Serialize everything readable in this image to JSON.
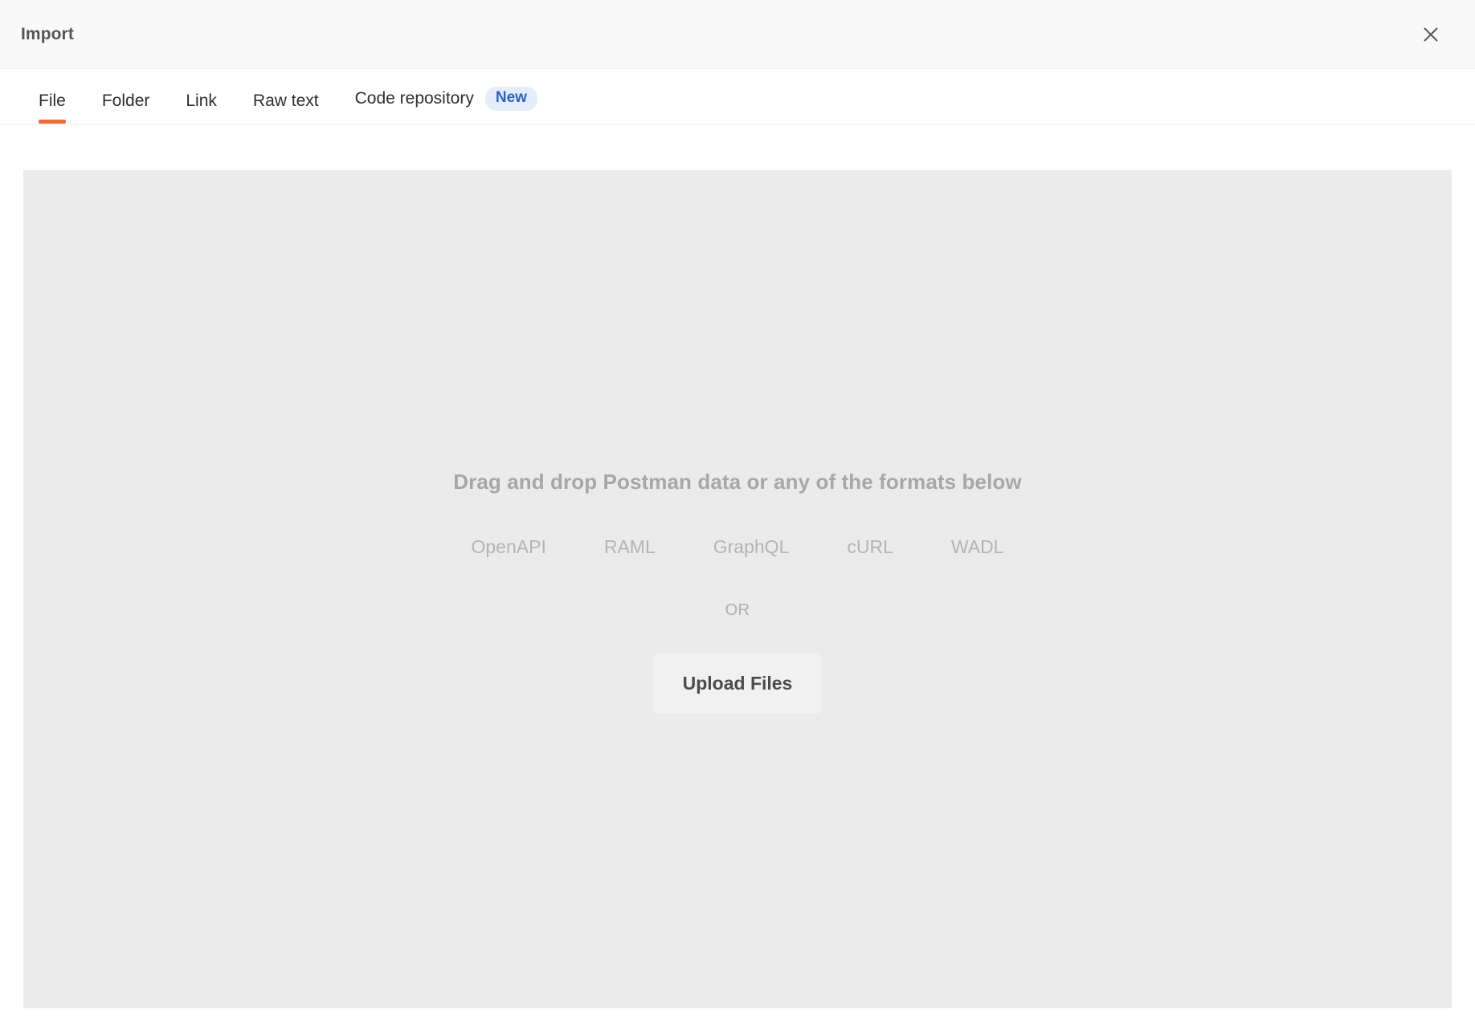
{
  "header": {
    "title": "Import",
    "close_icon": "close-icon"
  },
  "tabs": [
    {
      "label": "File",
      "active": true
    },
    {
      "label": "Folder",
      "active": false
    },
    {
      "label": "Link",
      "active": false
    },
    {
      "label": "Raw text",
      "active": false
    },
    {
      "label": "Code repository",
      "active": false,
      "badge": "New"
    }
  ],
  "dropzone": {
    "headline": "Drag and drop Postman data or any of the formats below",
    "formats": [
      "OpenAPI",
      "RAML",
      "GraphQL",
      "cURL",
      "WADL"
    ],
    "or_label": "OR",
    "upload_button": "Upload Files"
  },
  "colors": {
    "accent_active_tab": "#ef6c36",
    "badge_bg": "#e5edfb",
    "badge_text": "#2b63c4",
    "dropzone_bg": "#ebebeb",
    "upload_button_bg": "#f1f1f1",
    "header_bg": "#f9f9f9",
    "muted_text": "#b4b4b4"
  }
}
